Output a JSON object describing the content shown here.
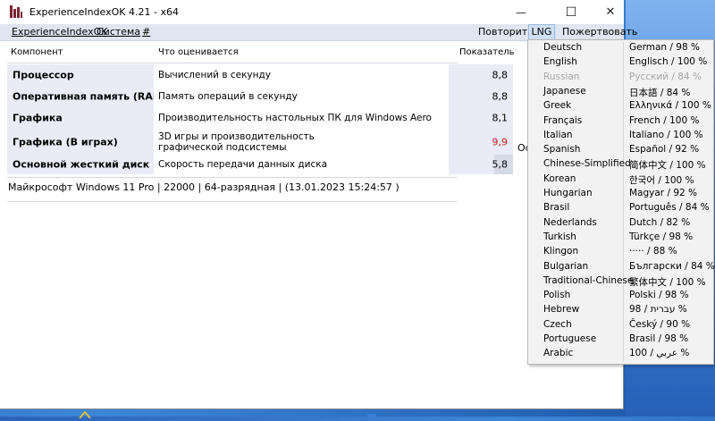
{
  "window": {
    "title": "ExperienceIndexOK 4.21 - x64",
    "controls": {
      "minimize": "—",
      "maximize": "☐",
      "close": "✕"
    }
  },
  "menubar": {
    "left": [
      "ExperienceIndexOK",
      "Система",
      "#"
    ],
    "right": {
      "repeat": "Повторить",
      "lng": "LNG",
      "donate": "Пожертвовать"
    }
  },
  "table": {
    "headers": {
      "component": "Компонент",
      "rated": "Что оценивается",
      "score": "Показатель"
    },
    "rows": [
      {
        "component": "Процессор",
        "description": "Вычислений в секунду",
        "score": "8,8",
        "score_color": "#000000"
      },
      {
        "component": "Оперативная память (RAM)",
        "description": "Память операций в секунду",
        "score": "8,8",
        "score_color": "#000000"
      },
      {
        "component": "Графика",
        "description": "Производительность настольных ПК для Windows Aero",
        "score": "8,1",
        "score_color": "#000000"
      },
      {
        "component": "Графика (В играх)",
        "description": "3D игры и производительность графической подсистемы",
        "score": "9,9",
        "score_color": "#d42020"
      },
      {
        "component": "Основной жесткий диск",
        "description": "Скорость передачи данных диска",
        "score": "5,8",
        "score_color": "#000000"
      }
    ],
    "hidden_partial": "Ос"
  },
  "status": "Майкрософт Windows 11 Pro | 22000 | 64-разрядная | (13.01.2023 15:24:57 )",
  "languages": [
    {
      "name": "Deutsch",
      "native": "German / 98 %"
    },
    {
      "name": "English",
      "native": "Englisch / 100 %"
    },
    {
      "name": "Russian",
      "native": "Русский / 84 %",
      "disabled": true
    },
    {
      "name": "Japanese",
      "native": "日本語 / 84 %"
    },
    {
      "name": "Greek",
      "native": "Ελληνικά / 100 %"
    },
    {
      "name": "Français",
      "native": "French / 100 %"
    },
    {
      "name": "Italian",
      "native": "Italiano / 100 %"
    },
    {
      "name": "Spanish",
      "native": "Español / 92 %"
    },
    {
      "name": "Chinese-Simplified",
      "native": "简体中文 / 100 %"
    },
    {
      "name": "Korean",
      "native": "한국어 / 100 %"
    },
    {
      "name": "Hungarian",
      "native": "Magyar / 92 %"
    },
    {
      "name": "Brasil",
      "native": "Português / 84 %"
    },
    {
      "name": "Nederlands",
      "native": "Dutch / 82 %"
    },
    {
      "name": "Turkish",
      "native": "Türkçe / 98 %"
    },
    {
      "name": "Klingon",
      "native": "····· / 88 %"
    },
    {
      "name": "Bulgarian",
      "native": "Български / 84 %"
    },
    {
      "name": "Traditional-Chinese",
      "native": "繁体中文 / 100 %"
    },
    {
      "name": "Polish",
      "native": "Polski / 98 %"
    },
    {
      "name": "Hebrew",
      "native": "98 / עברית %"
    },
    {
      "name": "Czech",
      "native": "Český / 90 %"
    },
    {
      "name": "Portuguese",
      "native": "Brasil / 98 %"
    },
    {
      "name": "Arabic",
      "native": "100 / عربي %"
    }
  ]
}
